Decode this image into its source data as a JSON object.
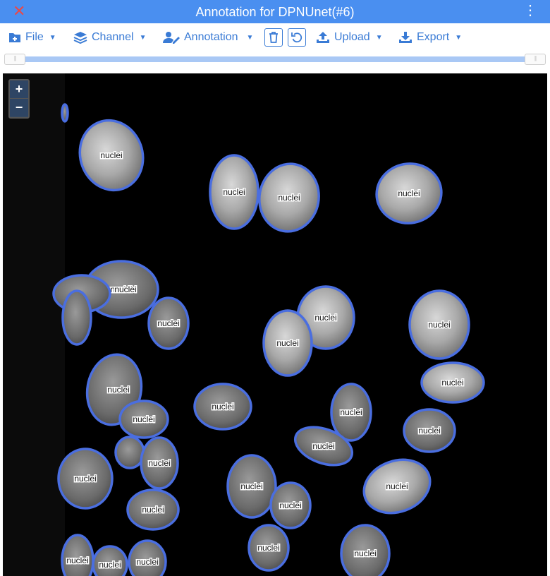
{
  "window": {
    "title": "Annotation for DPNUnet(#6)"
  },
  "toolbar": {
    "file_label": "File",
    "channel_label": "Channel",
    "annotation_label": "Annotation",
    "upload_label": "Upload",
    "export_label": "Export"
  },
  "zoom": {
    "in_label": "+",
    "out_label": "−"
  },
  "annotation_label": "nuclei",
  "colors": {
    "accent": "#3a7bd5",
    "titlebar": "#4a8ff0",
    "outline": "#4a6ee0",
    "close": "#e84a4a"
  }
}
